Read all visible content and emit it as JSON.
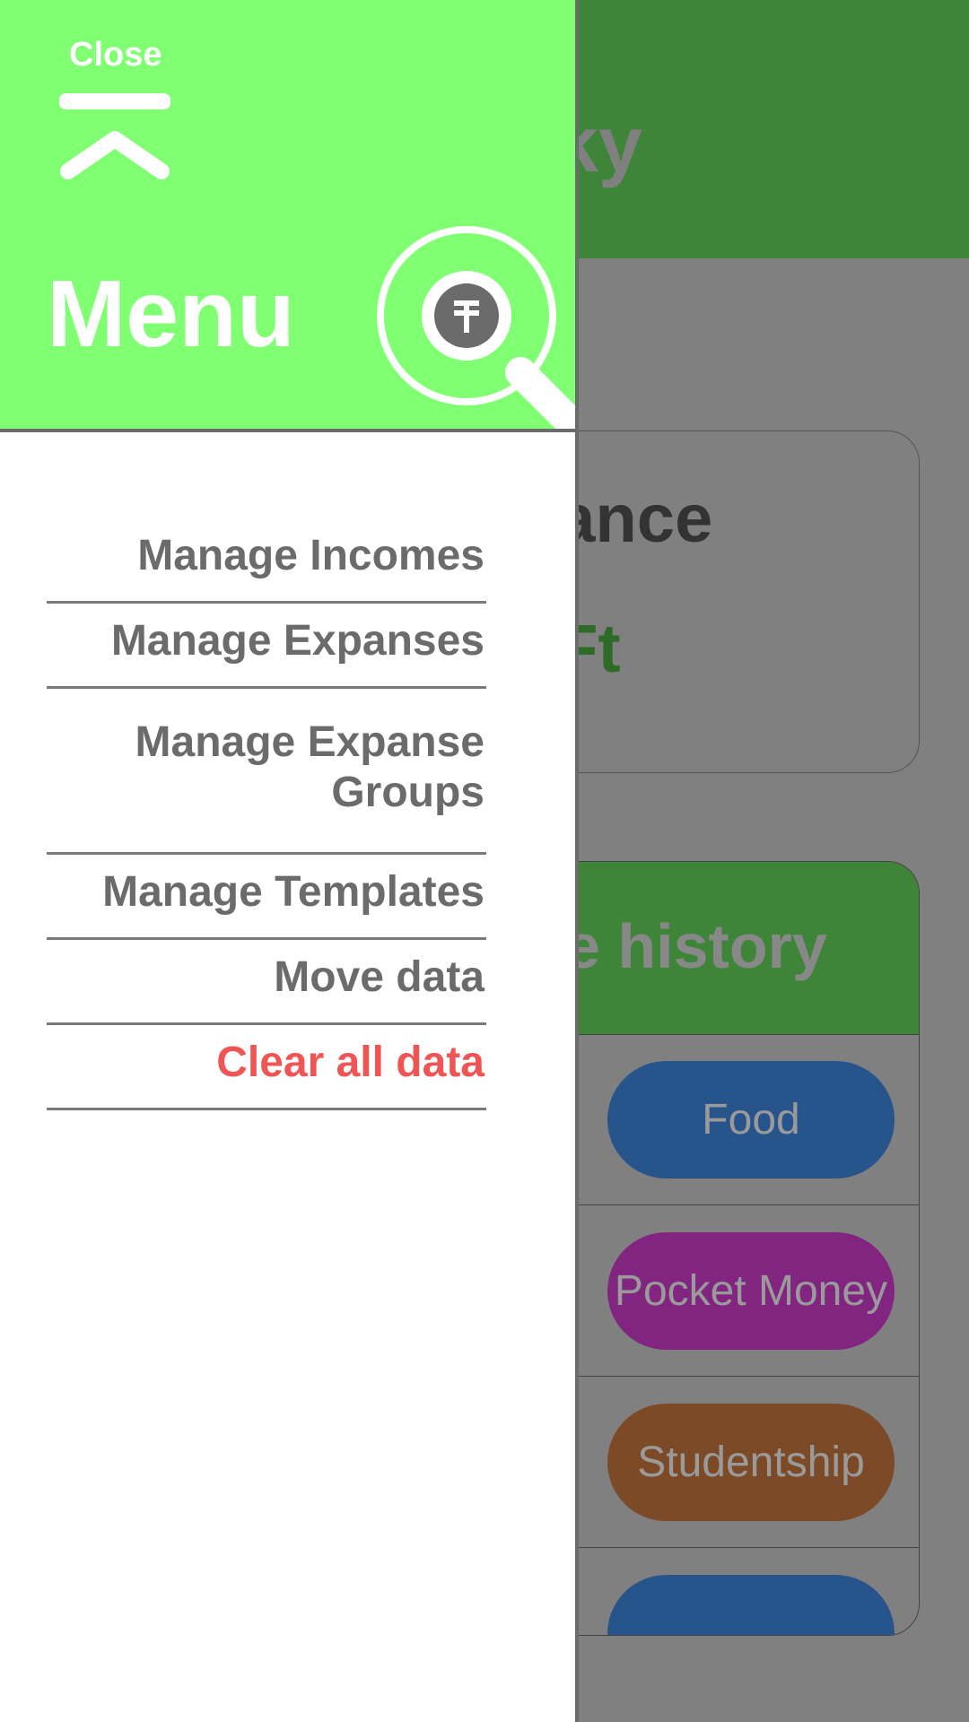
{
  "background": {
    "app_title_visible": "acky",
    "balance_label_visible": "lance",
    "balance_value_visible": "Ft",
    "history_title_visible": "e history",
    "history_items": [
      {
        "label": "Food",
        "color": "#27548a"
      },
      {
        "label": "Pocket Money",
        "color": "#812581"
      },
      {
        "label": "Studentship",
        "color": "#7d4a27"
      },
      {
        "label": "",
        "color": "#27548a"
      }
    ]
  },
  "drawer": {
    "close_label": "Close",
    "title": "Menu",
    "logo_icon": "coin-magnifier-icon",
    "close_icon": "chevron-up-icon",
    "items": [
      {
        "label": "Manage Incomes",
        "danger": false
      },
      {
        "label": "Manage Expanses",
        "danger": false
      },
      {
        "label": "Manage Expanse Groups",
        "danger": false
      },
      {
        "label": "Manage Templates",
        "danger": false
      },
      {
        "label": "Move data",
        "danger": false
      },
      {
        "label": "Clear all data",
        "danger": true
      }
    ]
  },
  "colors": {
    "drawer_header": "#80ff73",
    "app_header": "#3e8539",
    "overlay": "#808080",
    "danger": "#f05555",
    "menu_text": "#6b6b6b"
  }
}
